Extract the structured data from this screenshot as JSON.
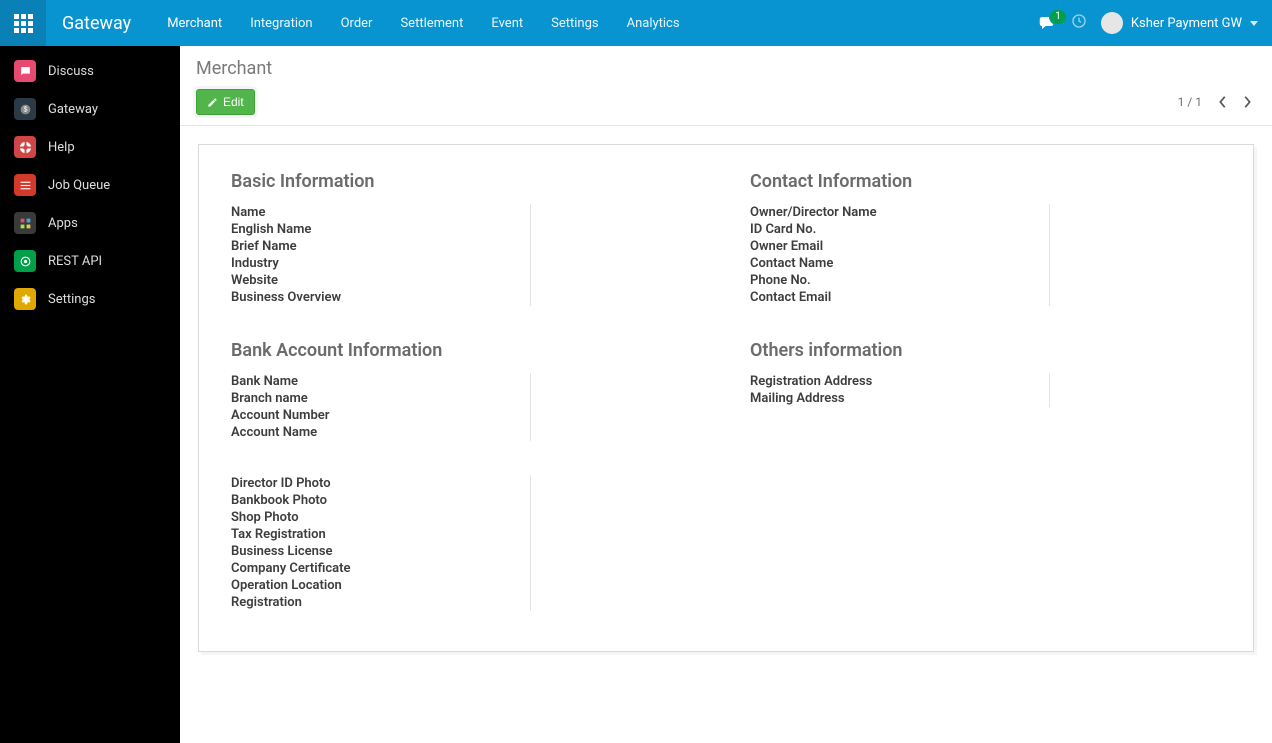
{
  "brand": "Gateway",
  "topmenu": {
    "items": [
      {
        "label": "Merchant",
        "active": true
      },
      {
        "label": "Integration"
      },
      {
        "label": "Order"
      },
      {
        "label": "Settlement"
      },
      {
        "label": "Event"
      },
      {
        "label": "Settings"
      },
      {
        "label": "Analytics"
      }
    ]
  },
  "notifications": {
    "count": "1"
  },
  "user": {
    "name": "Ksher Payment GW"
  },
  "sidebar": {
    "items": [
      {
        "label": "Discuss",
        "icon": "discuss"
      },
      {
        "label": "Gateway",
        "icon": "gateway"
      },
      {
        "label": "Help",
        "icon": "help"
      },
      {
        "label": "Job Queue",
        "icon": "jobqueue"
      },
      {
        "label": "Apps",
        "icon": "apps"
      },
      {
        "label": "REST API",
        "icon": "rest"
      },
      {
        "label": "Settings",
        "icon": "settings"
      }
    ]
  },
  "page": {
    "title": "Merchant",
    "edit_label": "Edit",
    "pager": "1 / 1",
    "sections": {
      "basic": {
        "title": "Basic Information",
        "fields": [
          "Name",
          "English Name",
          "Brief Name",
          "Industry",
          "Website",
          "Business Overview"
        ]
      },
      "contact": {
        "title": "Contact Information",
        "fields": [
          "Owner/Director Name",
          "ID Card No.",
          "Owner Email",
          "Contact Name",
          "Phone No.",
          "Contact Email"
        ]
      },
      "bank": {
        "title": "Bank Account Information",
        "fields": [
          "Bank Name",
          "Branch name",
          "Account Number",
          "Account Name"
        ]
      },
      "others": {
        "title": "Others information",
        "fields": [
          "Registration Address",
          "Mailing Address"
        ]
      },
      "docs": {
        "fields": [
          "Director ID Photo",
          "Bankbook Photo",
          "Shop Photo",
          "Tax Registration",
          "Business License",
          "Company Certificate",
          "Operation Location",
          "Registration"
        ]
      }
    }
  }
}
